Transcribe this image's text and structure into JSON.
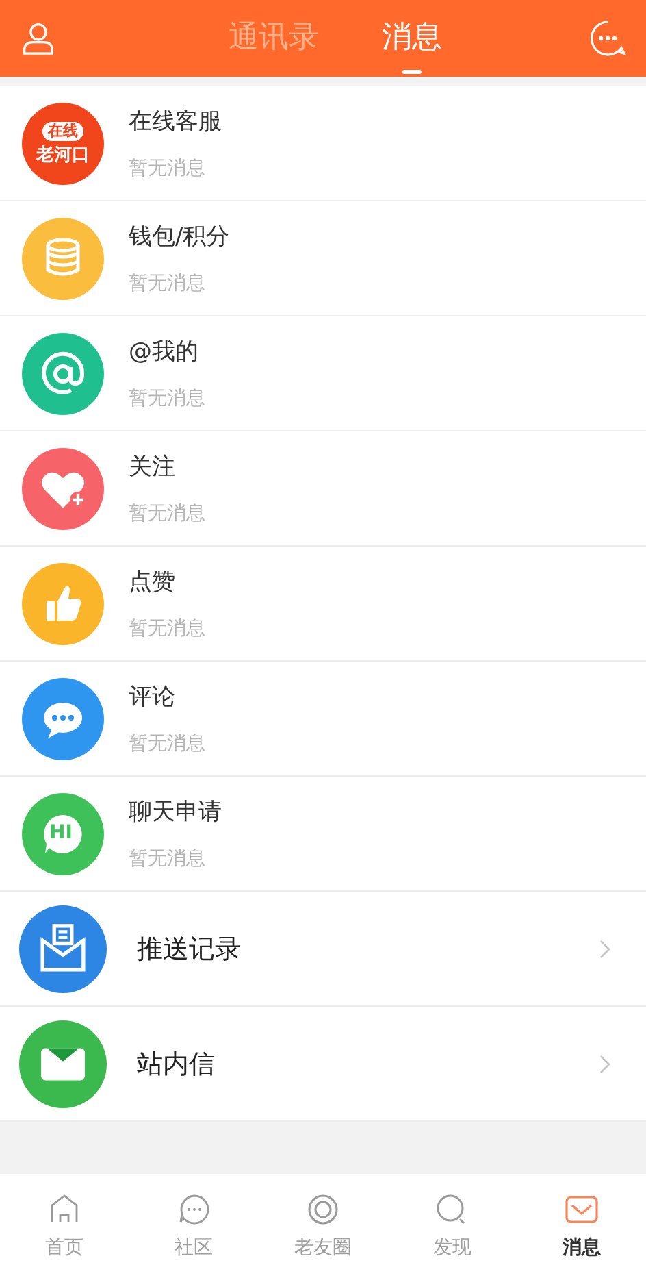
{
  "header": {
    "tabs": [
      {
        "label": "通讯录",
        "selected": false
      },
      {
        "label": "消息",
        "selected": true
      }
    ]
  },
  "messages": [
    {
      "kind": "logo",
      "title": "在线客服",
      "subtitle": "暂无消息",
      "logo_text": [
        "在线",
        "老河口"
      ]
    },
    {
      "kind": "coins",
      "title": "钱包/积分",
      "subtitle": "暂无消息",
      "color": "#fbbd3e"
    },
    {
      "kind": "at",
      "title": "@我的",
      "subtitle": "暂无消息",
      "color": "#1fbf8f"
    },
    {
      "kind": "heart",
      "title": "关注",
      "subtitle": "暂无消息",
      "color": "#f6646a"
    },
    {
      "kind": "thumb",
      "title": "点赞",
      "subtitle": "暂无消息",
      "color": "#fbb52a"
    },
    {
      "kind": "bubble",
      "title": "评论",
      "subtitle": "暂无消息",
      "color": "#2f96f0"
    },
    {
      "kind": "hi",
      "title": "聊天申请",
      "subtitle": "暂无消息",
      "color": "#3fc159",
      "icon_text": "HI"
    }
  ],
  "links": [
    {
      "kind": "inbox",
      "title": "推送记录",
      "color": "#2d86e3"
    },
    {
      "kind": "mail",
      "title": "站内信",
      "color": "#3bb84e"
    }
  ],
  "tabbar": [
    {
      "kind": "home",
      "label": "首页",
      "selected": false
    },
    {
      "kind": "chat",
      "label": "社区",
      "selected": false
    },
    {
      "kind": "ring",
      "label": "老友圈",
      "selected": false
    },
    {
      "kind": "search",
      "label": "发现",
      "selected": false
    },
    {
      "kind": "mail",
      "label": "消息",
      "selected": true
    }
  ]
}
